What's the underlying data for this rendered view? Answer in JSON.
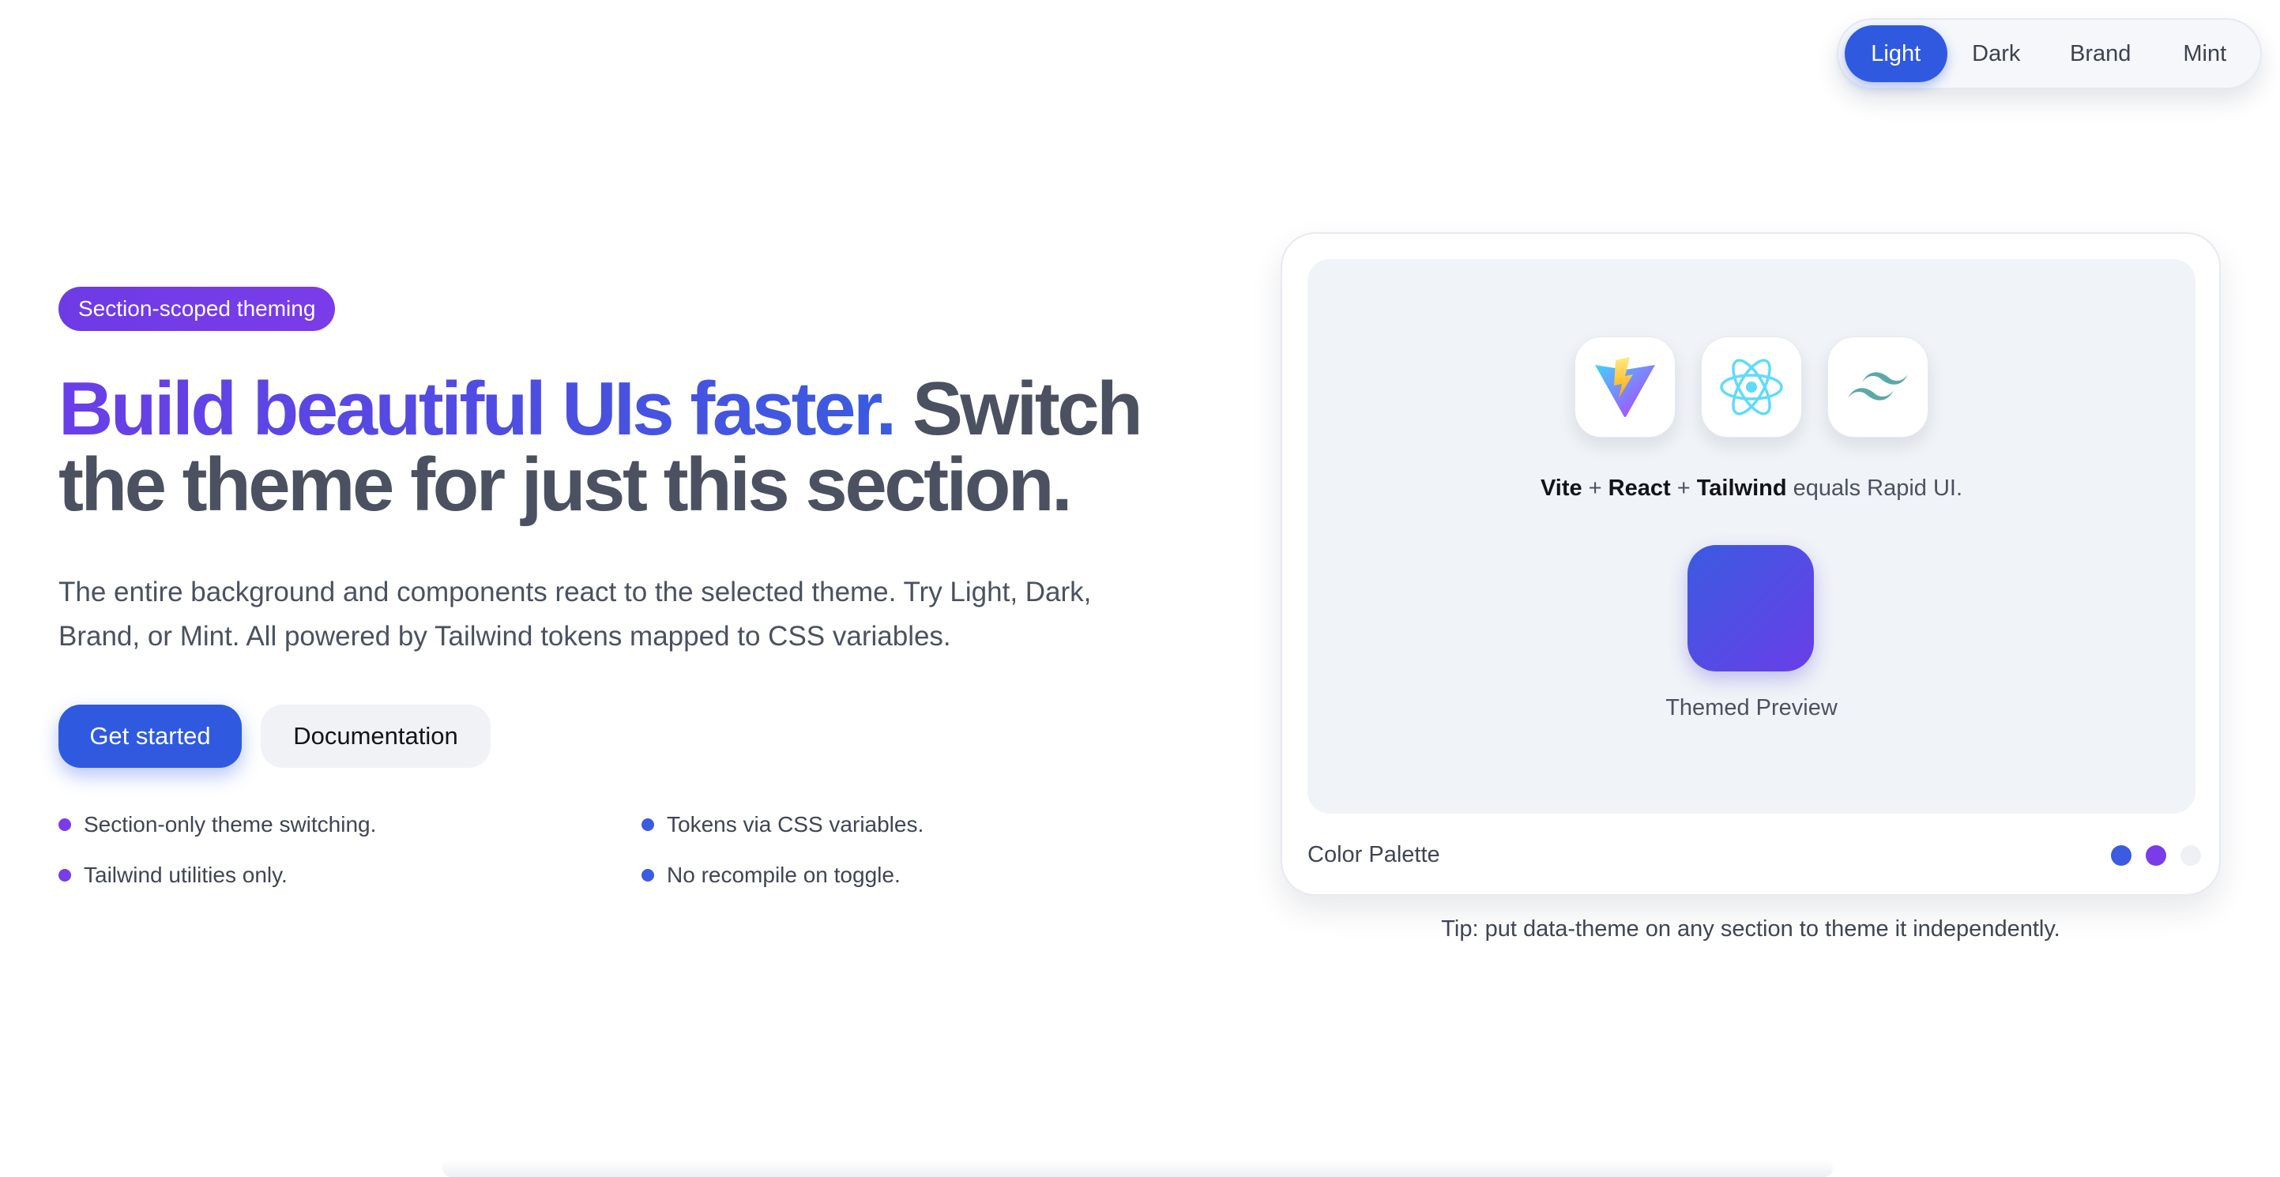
{
  "theme_switcher": {
    "options": [
      {
        "label": "Light",
        "active": true
      },
      {
        "label": "Dark",
        "active": false
      },
      {
        "label": "Brand",
        "active": false
      },
      {
        "label": "Mint",
        "active": false
      }
    ]
  },
  "hero": {
    "badge": "Section-scoped theming",
    "headline_highlight": "Build beautiful UIs faster.",
    "headline_rest": " Switch the theme for just this section.",
    "description": "The entire background and components react to the selected theme. Try Light, Dark, Brand, or Mint. All powered by Tailwind tokens mapped to CSS variables.",
    "primary_button": "Get started",
    "secondary_button": "Documentation",
    "features": [
      "Section-only theme switching.",
      "Tailwind utilities only.",
      "Tokens via CSS variables.",
      "No recompile on toggle."
    ]
  },
  "preview_card": {
    "logos": [
      "vite-icon",
      "react-icon",
      "tailwind-icon"
    ],
    "stack": {
      "vite": "Vite",
      "plus1": " + ",
      "react": "React",
      "plus2": " + ",
      "tailwind": "Tailwind",
      "suffix": " equals Rapid UI."
    },
    "preview_label": "Themed Preview",
    "palette_label": "Color Palette",
    "palette_colors": [
      "#3b5be0",
      "#7a3ce8",
      "#eef0f4"
    ]
  },
  "tip": "Tip: put data-theme on any section to theme it independently.",
  "colors": {
    "primary": "#2f5ae0",
    "accent_purple": "#7a3ce8",
    "text": "#4b5160"
  }
}
